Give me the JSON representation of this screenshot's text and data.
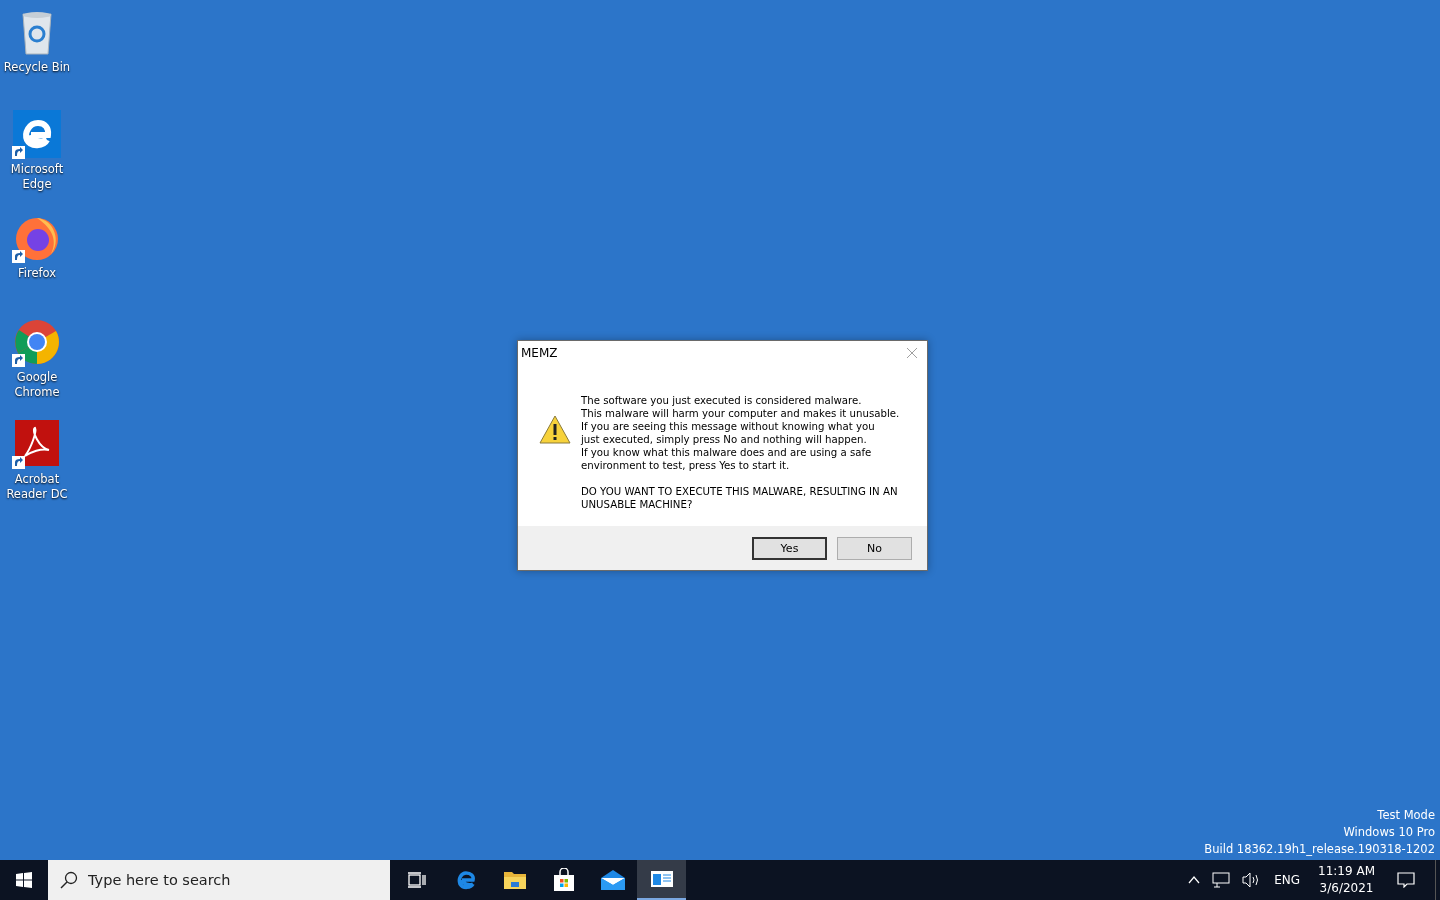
{
  "desktop": {
    "icons": [
      {
        "label": "Recycle Bin",
        "kind": "recycle",
        "shortcut": false
      },
      {
        "label": "Microsoft Edge",
        "kind": "edge",
        "shortcut": true
      },
      {
        "label": "Firefox",
        "kind": "firefox",
        "shortcut": true
      },
      {
        "label": "Google Chrome",
        "kind": "chrome",
        "shortcut": true
      },
      {
        "label": "Acrobat Reader DC",
        "kind": "acrobat",
        "shortcut": true
      }
    ],
    "watermark": [
      "Test Mode",
      "Windows 10 Pro",
      "Build 18362.19h1_release.190318-1202"
    ]
  },
  "dialog": {
    "title": "MEMZ",
    "message": [
      "The software you just executed is considered malware.",
      "This malware will harm your computer and makes it unusable.",
      "If you are seeing this message without knowing what you",
      "just executed, simply press No and nothing will happen.",
      "If you know what this malware does and are using a safe",
      "environment to test, press Yes to start it."
    ],
    "question": [
      "DO YOU WANT TO EXECUTE THIS MALWARE, RESULTING IN AN",
      "UNUSABLE MACHINE?"
    ],
    "buttons": [
      {
        "label": "Yes",
        "selected": true
      },
      {
        "label": "No",
        "selected": false
      }
    ]
  },
  "taskbar": {
    "search": {
      "placeholder": "Type here to search"
    },
    "apps": [
      {
        "kind": "taskview",
        "active": false
      },
      {
        "kind": "edge",
        "active": false
      },
      {
        "kind": "explorer",
        "active": false
      },
      {
        "kind": "store",
        "active": false
      },
      {
        "kind": "mail",
        "active": false
      },
      {
        "kind": "window",
        "active": true
      }
    ],
    "tray": {
      "language": "ENG",
      "time": "11:19 AM",
      "date": "3/6/2021"
    }
  }
}
